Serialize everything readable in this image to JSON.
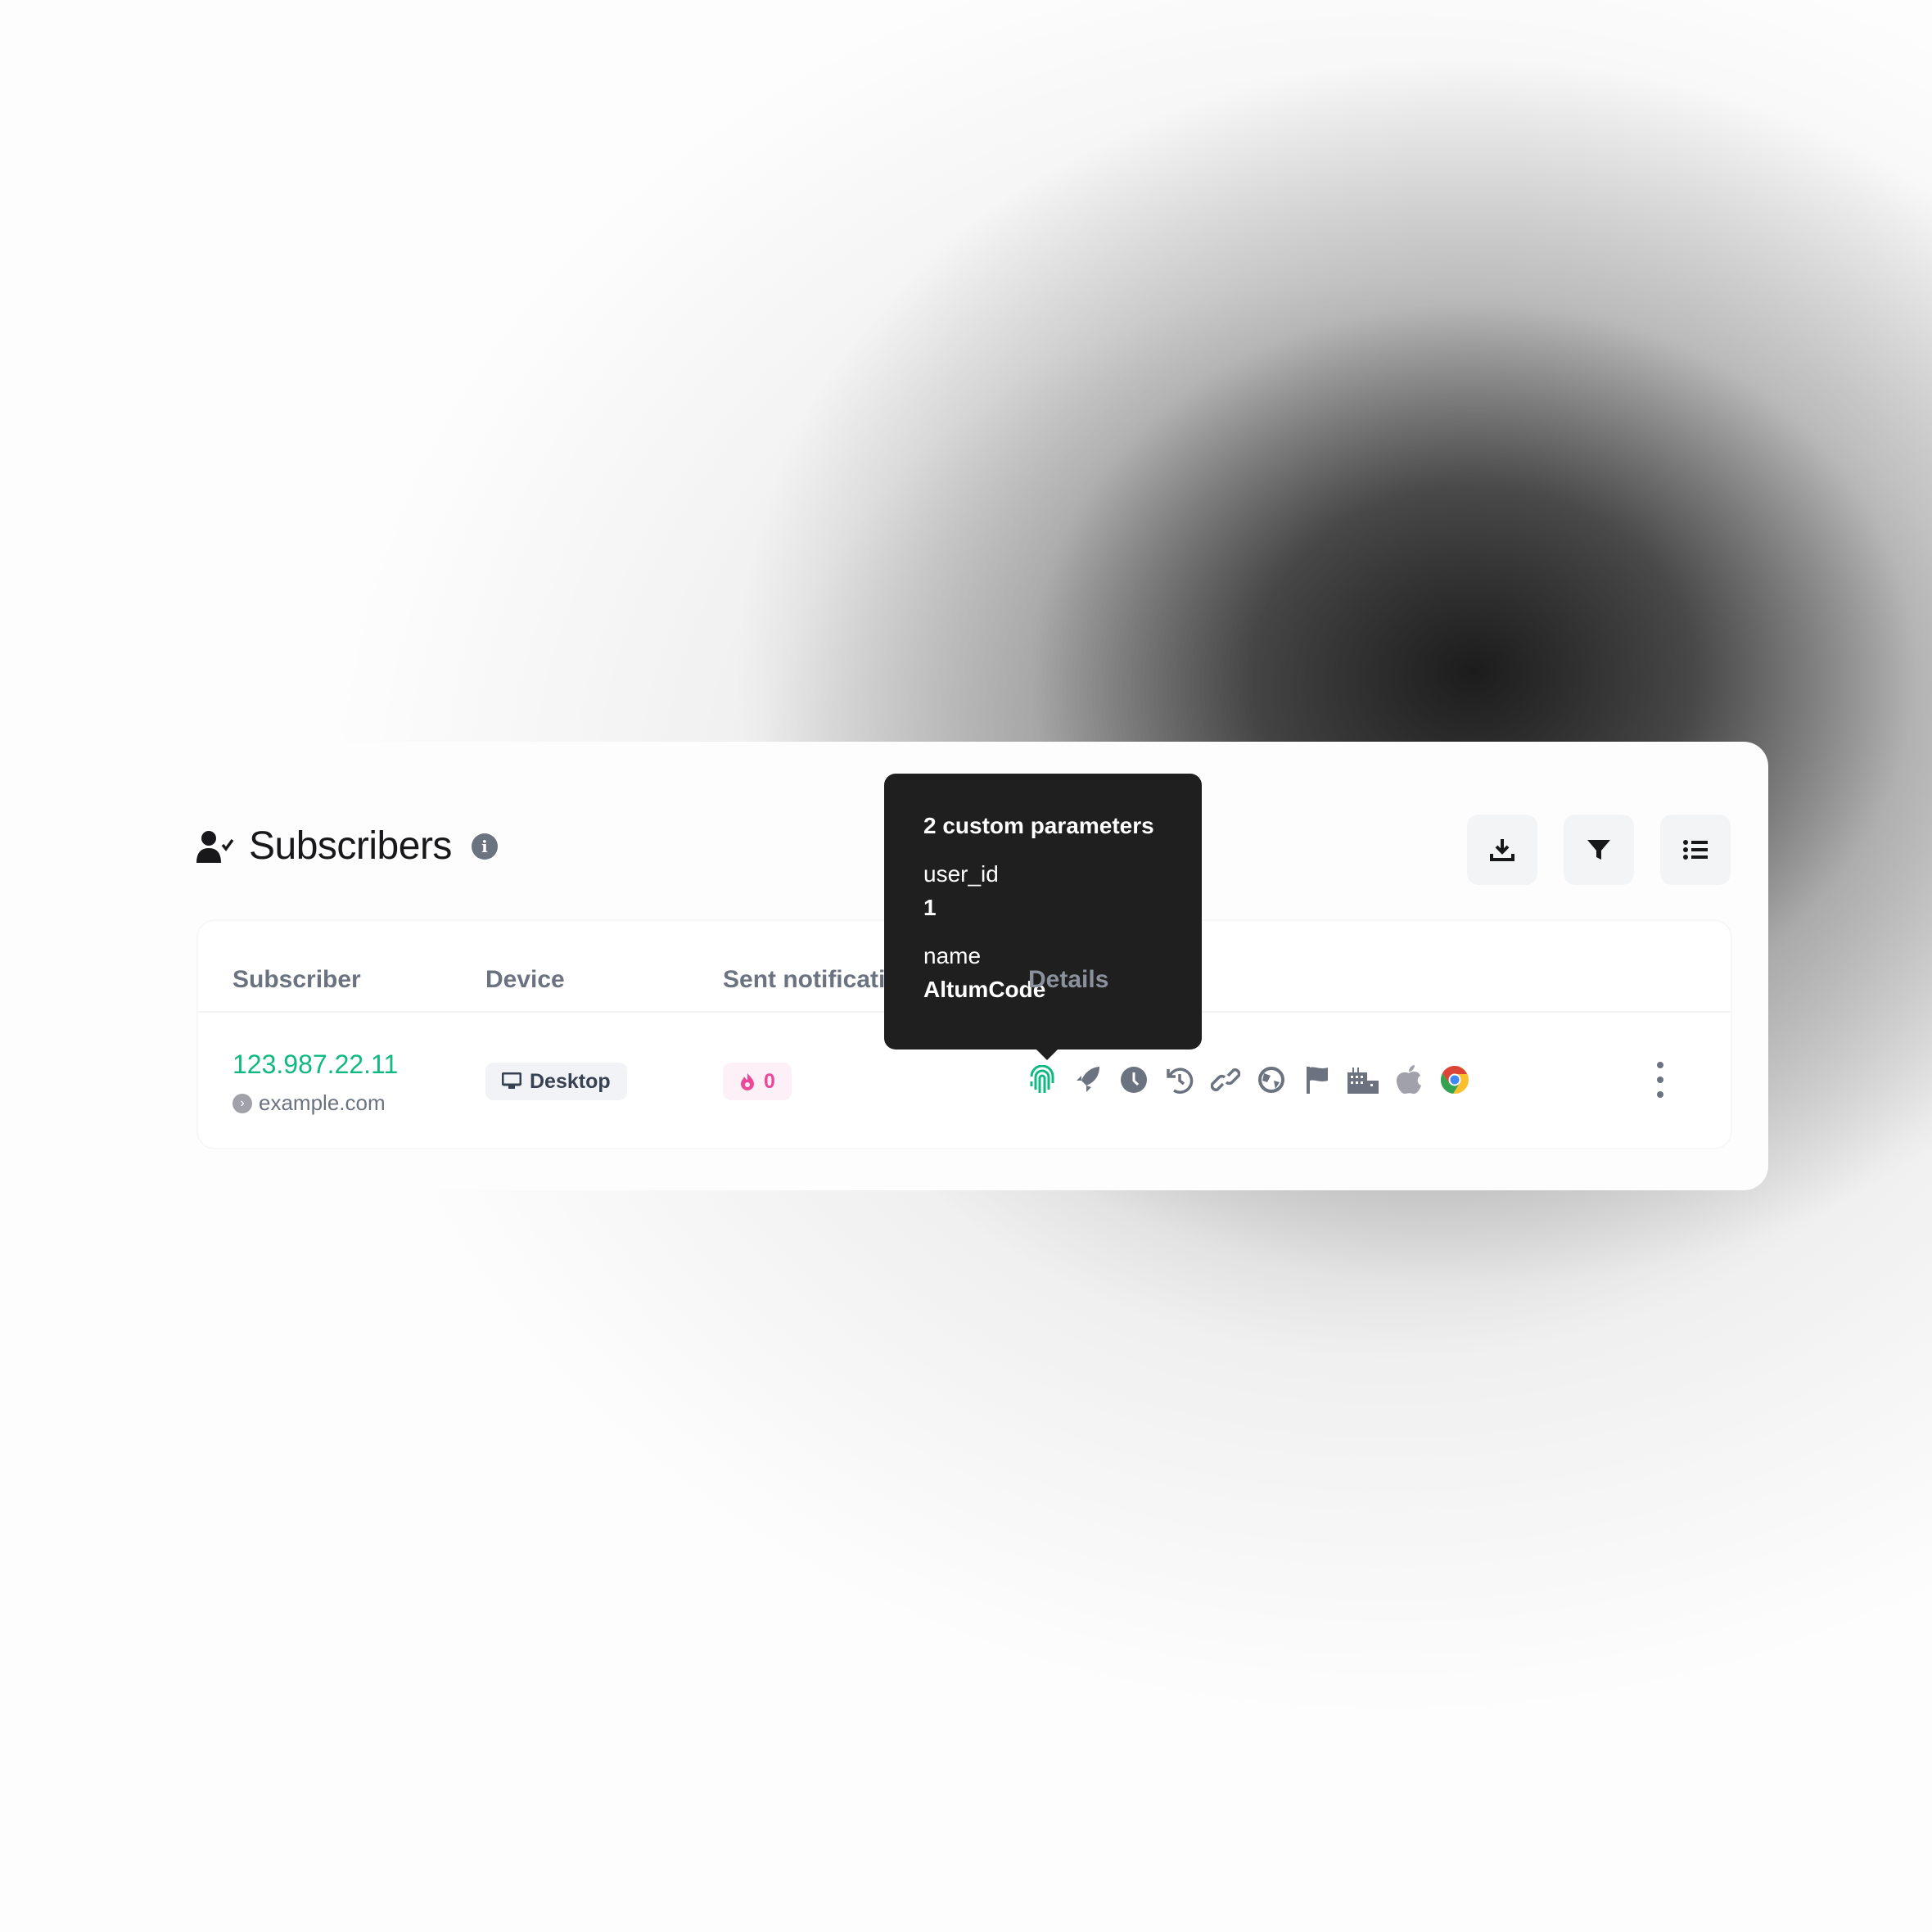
{
  "header": {
    "title": "Subscribers",
    "info_icon": "i"
  },
  "toolbar": {
    "download": "download-icon",
    "filter": "filter-icon",
    "columns": "list-icon"
  },
  "table": {
    "columns": [
      "Subscriber",
      "Device",
      "Sent notifications",
      "Details"
    ],
    "rows": [
      {
        "ip": "123.987.22.11",
        "domain": "example.com",
        "device": "Desktop",
        "sent": "0",
        "detail_icons": [
          "fingerprint",
          "rocket",
          "clock",
          "history",
          "link",
          "globe",
          "flag",
          "city",
          "apple",
          "chrome"
        ]
      }
    ]
  },
  "tooltip": {
    "title": "2 custom parameters",
    "params": [
      {
        "key": "user_id",
        "value": "1"
      },
      {
        "key": "name",
        "value": "AltumCode"
      }
    ]
  },
  "colors": {
    "accent": "#10b981",
    "pink": "#ec4899",
    "tooltip_bg": "#1f1f1f",
    "icon_gray": "#6b7280"
  }
}
